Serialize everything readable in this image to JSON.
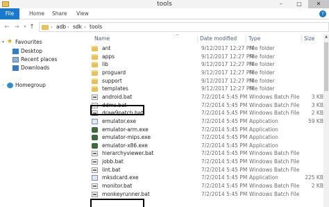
{
  "window": {
    "title": "tools"
  },
  "ribbon": {
    "tabs": [
      "File",
      "Home",
      "Share",
      "View"
    ]
  },
  "address": {
    "crumbs": [
      "adb",
      "sdk",
      "tools"
    ]
  },
  "nav": {
    "favourites": "Favourites",
    "items": [
      "Desktop",
      "Recent places",
      "Downloads"
    ],
    "homegroup": "Homegroup"
  },
  "columns": {
    "name": "Name",
    "date": "Date modified",
    "type": "Type",
    "size": "Size"
  },
  "files": [
    {
      "name": "ant",
      "date": "9/12/2017 12:27 PM",
      "type": "File folder",
      "size": "",
      "icon": "folder"
    },
    {
      "name": "apps",
      "date": "9/12/2017 12:27 PM",
      "type": "File folder",
      "size": "",
      "icon": "folder"
    },
    {
      "name": "lib",
      "date": "9/12/2017 12:27 PM",
      "type": "File folder",
      "size": "",
      "icon": "folder"
    },
    {
      "name": "proguard",
      "date": "9/12/2017 12:27 PM",
      "type": "File folder",
      "size": "",
      "icon": "folder"
    },
    {
      "name": "support",
      "date": "9/12/2017 12:27 PM",
      "type": "File folder",
      "size": "",
      "icon": "folder"
    },
    {
      "name": "templates",
      "date": "9/12/2017 12:27 PM",
      "type": "File folder",
      "size": "",
      "icon": "folder"
    },
    {
      "name": "android.bat",
      "date": "7/2/2014 5:45 PM",
      "type": "Windows Batch File",
      "size": "3 KB",
      "icon": "bat"
    },
    {
      "name": "ddms.bat",
      "date": "7/2/2014 5:45 PM",
      "type": "Windows Batch File",
      "size": "3 KB",
      "icon": "bat"
    },
    {
      "name": "draw9patch.bat",
      "date": "7/2/2014 5:45 PM",
      "type": "Windows Batch File",
      "size": "2 KB",
      "icon": "bat"
    },
    {
      "name": "emulator.exe",
      "date": "7/2/2014 5:45 PM",
      "type": "Application",
      "size": "59 KB",
      "icon": "exe-win"
    },
    {
      "name": "emulator-arm.exe",
      "date": "7/2/2014 5:45 PM",
      "type": "Application",
      "size": "",
      "icon": "exe"
    },
    {
      "name": "emulator-mips.exe",
      "date": "7/2/2014 5:45 PM",
      "type": "Application",
      "size": "",
      "icon": "exe"
    },
    {
      "name": "emulator-x86.exe",
      "date": "7/2/2014 5:45 PM",
      "type": "Application",
      "size": "",
      "icon": "exe"
    },
    {
      "name": "hierarchyviewer.bat",
      "date": "7/2/2014 5:45 PM",
      "type": "Windows Batch File",
      "size": "",
      "icon": "bat"
    },
    {
      "name": "jobb.bat",
      "date": "7/2/2014 5:45 PM",
      "type": "Windows Batch File",
      "size": "",
      "icon": "bat"
    },
    {
      "name": "lint.bat",
      "date": "7/2/2014 5:45 PM",
      "type": "Windows Batch File",
      "size": "",
      "icon": "bat"
    },
    {
      "name": "mksdcard.exe",
      "date": "7/2/2014 5:45 PM",
      "type": "Application",
      "size": "225 KB",
      "icon": "exe-win"
    },
    {
      "name": "monitor.bat",
      "date": "7/2/2014 5:45 PM",
      "type": "Windows Batch File",
      "size": "2 KB",
      "icon": "bat"
    },
    {
      "name": "monkeyrunner.bat",
      "date": "7/2/2014 5:45 PM",
      "type": "Windows Batch File",
      "size": "",
      "icon": "bat"
    }
  ],
  "highlighted": [
    "ddms.bat",
    "monitor.bat"
  ]
}
